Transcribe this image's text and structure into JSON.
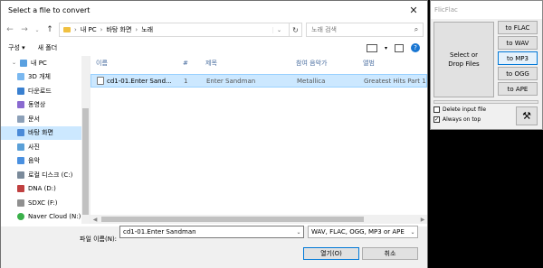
{
  "dialog": {
    "title": "Select a file to convert",
    "breadcrumb": [
      "내 PC",
      "바탕 화면",
      "노래"
    ],
    "search_placeholder": "노래 검색",
    "toolbar": {
      "organize": "구성 ▾",
      "new_folder": "새 폴더"
    },
    "sidebar": [
      {
        "label": "내 PC",
        "icon": "pc-icon",
        "color": "#5aa0e0"
      },
      {
        "label": "3D 개체",
        "icon": "3d-objects-icon",
        "color": "#7ab8f0"
      },
      {
        "label": "다운로드",
        "icon": "download-icon",
        "color": "#3a80d0"
      },
      {
        "label": "동영상",
        "icon": "video-icon",
        "color": "#8a6ad0"
      },
      {
        "label": "문서",
        "icon": "documents-icon",
        "color": "#8ca0b8"
      },
      {
        "label": "바탕 화면",
        "icon": "desktop-icon",
        "color": "#4a8ad8"
      },
      {
        "label": "사진",
        "icon": "pictures-icon",
        "color": "#5aa0d8"
      },
      {
        "label": "음악",
        "icon": "music-icon",
        "color": "#4a90e0"
      },
      {
        "label": "로컬 디스크 (C:)",
        "icon": "drive-icon",
        "color": "#7a8a9a"
      },
      {
        "label": "DNA (D:)",
        "icon": "drive-icon",
        "color": "#c04040"
      },
      {
        "label": "SDXC (F:)",
        "icon": "sd-card-icon",
        "color": "#909090"
      },
      {
        "label": "Naver Cloud (N:)",
        "icon": "cloud-icon",
        "color": "#3ab04a"
      }
    ],
    "columns": [
      "이름",
      "#",
      "제목",
      "참여 음악가",
      "앨범"
    ],
    "files": [
      {
        "name": "cd1-01.Enter Sand...",
        "num": "1",
        "title": "Enter Sandman",
        "artist": "Metallica",
        "album": "Greatest Hits Part 1"
      }
    ],
    "filename_label": "파일 이름(N):",
    "filename_value": "cd1-01.Enter Sandman",
    "filetype_value": "WAV, FLAC, OGG, MP3 or APE",
    "open_label": "열기(O)",
    "cancel_label": "취소"
  },
  "flicflac": {
    "title": "FlicFlac",
    "select_label": "Select or Drop Files",
    "buttons": [
      "to FLAC",
      "to WAV",
      "to MP3",
      "to OGG",
      "to APE"
    ],
    "selected": "to MP3",
    "delete_input": "Delete input file",
    "always_on_top": "Always on top",
    "delete_checked": false,
    "top_checked": true
  }
}
